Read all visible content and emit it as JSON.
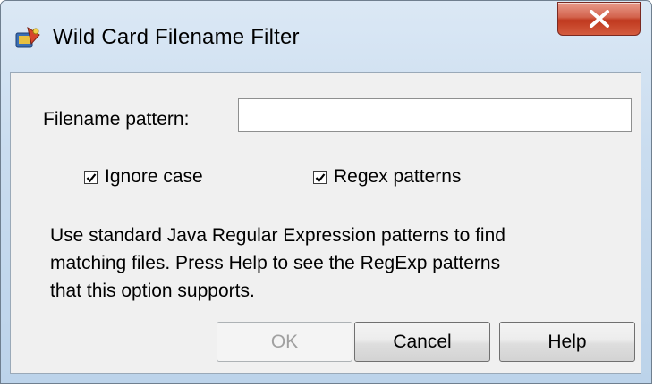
{
  "window": {
    "title": "Wild Card Filename Filter",
    "close_label": "X"
  },
  "form": {
    "pattern_label": "Filename pattern:",
    "pattern_value": "",
    "pattern_placeholder": ""
  },
  "options": {
    "ignore_case": {
      "label": "Ignore case",
      "checked": true
    },
    "regex_patterns": {
      "label": "Regex patterns",
      "checked": true
    }
  },
  "help_text": {
    "line1": "Use standard Java Regular Expression patterns to find",
    "line2": "matching files. Press Help to see the RegExp patterns",
    "line3": "that this option supports."
  },
  "buttons": {
    "ok_label": "OK",
    "ok_enabled": false,
    "cancel_label": "Cancel",
    "help_label": "Help"
  },
  "icons": {
    "app": "app-icon",
    "close": "close-icon",
    "check": "checkmark-icon"
  },
  "colors": {
    "close_button": "#c0391f",
    "dialog_background": "#f0f0f0",
    "disabled_text": "#a0a0a0"
  }
}
